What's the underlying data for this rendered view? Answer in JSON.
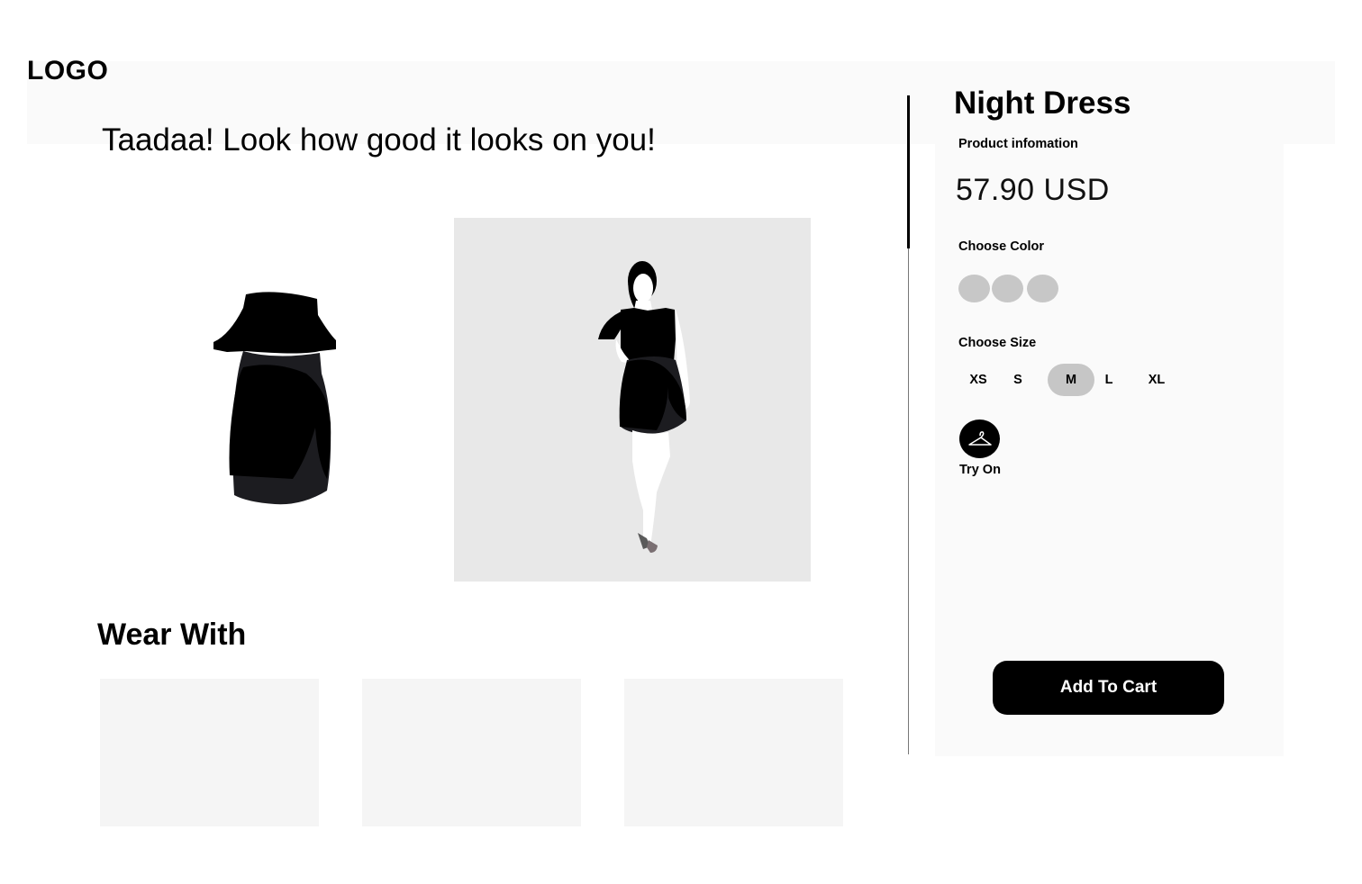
{
  "header": {
    "logo": "LOGO"
  },
  "main": {
    "headline": "Taadaa! Look how good it looks on you!",
    "wear_with": {
      "title": "Wear With",
      "cards": [
        {},
        {},
        {}
      ]
    }
  },
  "product": {
    "name": "Night Dress",
    "info_label": "Product infomation",
    "price": "57.90 USD",
    "color_label": "Choose Color",
    "colors": [
      "#c7c7c7",
      "#c7c7c7",
      "#c7c7c7"
    ],
    "size_label": "Choose Size",
    "sizes": [
      "XS",
      "S",
      "M",
      "L",
      "XL"
    ],
    "selected_size": "M",
    "try_on_label": "Try On",
    "add_to_cart_label": "Add To Cart"
  },
  "icons": {
    "try_on": "hanger-icon"
  }
}
